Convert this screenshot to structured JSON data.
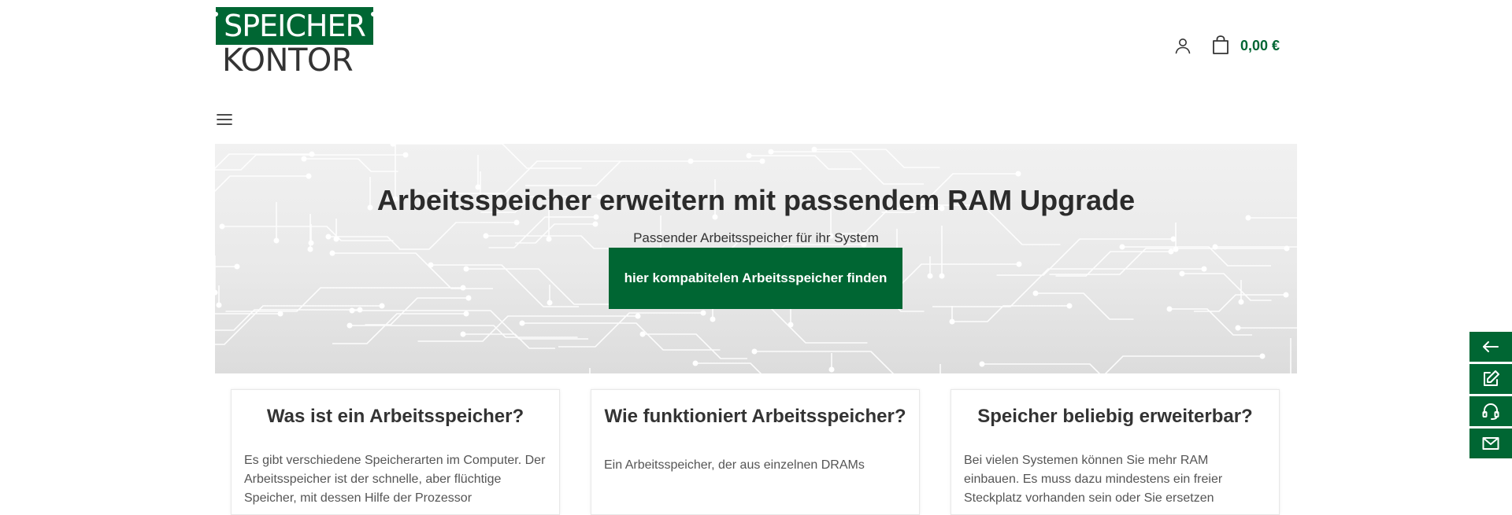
{
  "logo": {
    "line1": "SPEICHER",
    "line2": "KONTOR",
    "brand_color": "#006633"
  },
  "header": {
    "account_icon": "user-icon",
    "cart_icon": "shopping-bag-icon",
    "cart_total": "0,00 €"
  },
  "nav": {
    "menu_icon": "hamburger-menu-icon"
  },
  "hero": {
    "title": "Arbeitsspeicher erweitern mit passendem RAM Upgrade",
    "subtitle": "Passender Arbeitsspeicher für ihr System",
    "cta_label": "hier kompabitelen Arbeitsspeicher finden"
  },
  "cards": [
    {
      "title": "Was ist ein Arbeitsspeicher?",
      "text": "Es gibt verschiedene Speicherarten im Computer. Der Arbeitsspeicher ist der schnelle, aber flüchtige Speicher, mit dessen Hilfe der Prozessor"
    },
    {
      "title": "Wie funktioniert Arbeitsspeicher?",
      "text": "Ein Arbeitsspeicher, der aus einzelnen DRAMs"
    },
    {
      "title": "Speicher beliebig erweiterbar?",
      "text": "Bei vielen Systemen können Sie mehr RAM einbauen. Es muss dazu mindestens ein freier Steckplatz vorhanden sein oder Sie ersetzen"
    }
  ],
  "side_actions": [
    {
      "icon": "arrow-left-icon"
    },
    {
      "icon": "edit-note-icon"
    },
    {
      "icon": "headset-icon"
    },
    {
      "icon": "mail-icon"
    }
  ],
  "colors": {
    "accent": "#006633",
    "text": "#333333"
  }
}
